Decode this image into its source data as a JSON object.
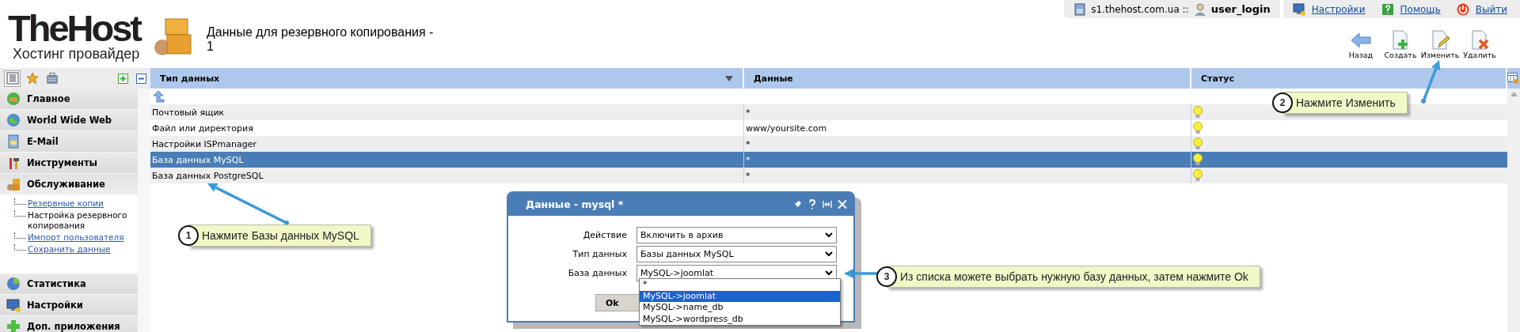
{
  "logo": {
    "title": "TheHost",
    "subtitle": "Хостинг провайдер"
  },
  "page_title": "Данные для резервного копирования - 1",
  "top_bar": {
    "server": "s1.thehost.com.ua ::",
    "user": "user_login",
    "links": [
      "Настройки",
      "Помощь",
      "Выйти"
    ]
  },
  "toolbar": [
    "Назад",
    "Создать",
    "Изменить",
    "Удалить"
  ],
  "sidebar": {
    "views": [
      {
        "selected": true
      },
      {
        "selected": false
      },
      {
        "selected": false
      }
    ],
    "items": [
      {
        "label": "Главное"
      },
      {
        "label": "World Wide Web"
      },
      {
        "label": "E-Mail"
      },
      {
        "label": "Инструменты"
      },
      {
        "label": "Обслуживание",
        "expanded": true,
        "children": [
          {
            "label": "Резервные копии",
            "selected": false
          },
          {
            "label": "Настройка резервного копирования",
            "selected": true
          },
          {
            "label": "Импорт пользователя",
            "selected": false
          },
          {
            "label": "Сохранить данные",
            "selected": false
          }
        ]
      },
      {
        "label": "Статистика"
      },
      {
        "label": "Настройки"
      },
      {
        "label": "Доп. приложения"
      }
    ]
  },
  "table": {
    "columns": [
      "Тип данных",
      "Данные",
      "Статус"
    ],
    "rows": [
      {
        "type": "Почтовый ящик",
        "data": "*",
        "selected": false
      },
      {
        "type": "Файл или директория",
        "data": "www/yoursite.com",
        "selected": false
      },
      {
        "type": "Настройки ISPmanager",
        "data": "*",
        "selected": false
      },
      {
        "type": "База данных MySQL",
        "data": "*",
        "selected": true
      },
      {
        "type": "База данных PostgreSQL",
        "data": "*",
        "selected": false
      }
    ]
  },
  "dialog": {
    "title": "Данные - mysql *",
    "fields": [
      {
        "label": "Действие",
        "value": "Включить в архив"
      },
      {
        "label": "Тип данных",
        "value": "Базы данных MySQL"
      },
      {
        "label": "База данных",
        "value": "MySQL->joomlat"
      }
    ],
    "options": [
      {
        "label": "*",
        "selected": false
      },
      {
        "label": "MySQL->joomlat",
        "selected": true
      },
      {
        "label": "MySQL->name_db",
        "selected": false
      },
      {
        "label": "MySQL->wordpress_db",
        "selected": false
      }
    ],
    "ok": "Ok"
  },
  "callouts": [
    {
      "number": "1",
      "text": "Нажмите Базы данных MySQL"
    },
    {
      "number": "2",
      "text": "Нажмите Изменить"
    },
    {
      "number": "3",
      "text": "Из списка можете выбрать нужную базу данных, затем нажмите Ok"
    }
  ]
}
